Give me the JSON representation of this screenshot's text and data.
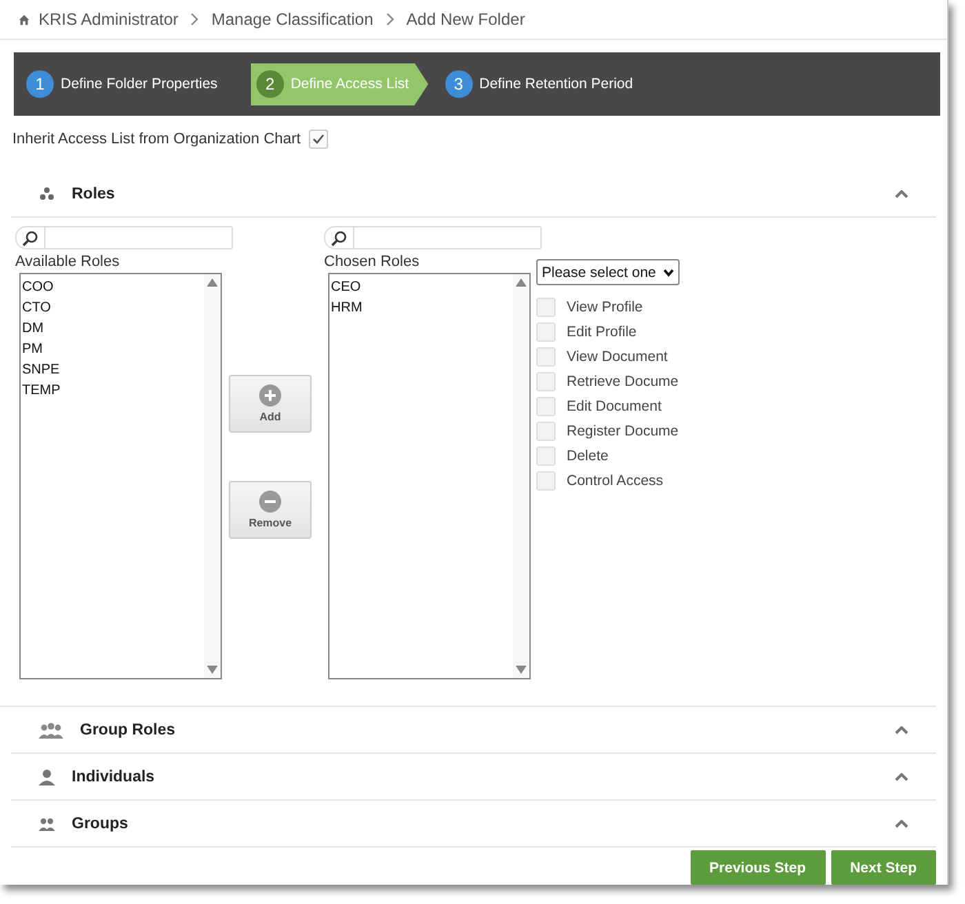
{
  "breadcrumb": [
    "KRIS Administrator",
    "Manage Classification",
    "Add New Folder"
  ],
  "steps": [
    {
      "number": "1",
      "label": "Define Folder Properties",
      "selected": false
    },
    {
      "number": "2",
      "label": "Define Access List",
      "selected": true
    },
    {
      "number": "3",
      "label": "Define Retention Period",
      "selected": false
    }
  ],
  "inherit": {
    "label": "Inherit Access List from Organization Chart",
    "checked": true
  },
  "roles": {
    "title": "Roles",
    "available": {
      "label": "Available Roles",
      "items": [
        {
          "label": "COO",
          "selected": false
        },
        {
          "label": "CTO",
          "selected": false
        },
        {
          "label": "DM",
          "selected": false
        },
        {
          "label": "PM",
          "selected": false
        },
        {
          "label": "SNPE",
          "selected": false
        },
        {
          "label": "TEMP",
          "selected": false
        }
      ]
    },
    "chosen": {
      "label": "Chosen Roles",
      "items": [
        {
          "label": "CEO",
          "selected": false
        },
        {
          "label": "HRM",
          "selected": false
        }
      ]
    },
    "add_button": "Add",
    "remove_button": "Remove",
    "select": {
      "value": "Please select one"
    },
    "permissions": [
      {
        "label": "View Profile",
        "checked": false
      },
      {
        "label": "Edit Profile",
        "checked": false
      },
      {
        "label": "View Document",
        "checked": false
      },
      {
        "label": "Retrieve Docume",
        "checked": false
      },
      {
        "label": "Edit Document",
        "checked": false
      },
      {
        "label": "Register Docume",
        "checked": false
      },
      {
        "label": "Delete",
        "checked": false
      },
      {
        "label": "Control Access",
        "checked": false
      }
    ]
  },
  "sections": [
    {
      "title": "Group Roles"
    },
    {
      "title": "Individuals"
    },
    {
      "title": "Groups"
    }
  ],
  "buttons": [
    "Previous Step",
    "Next Step"
  ]
}
